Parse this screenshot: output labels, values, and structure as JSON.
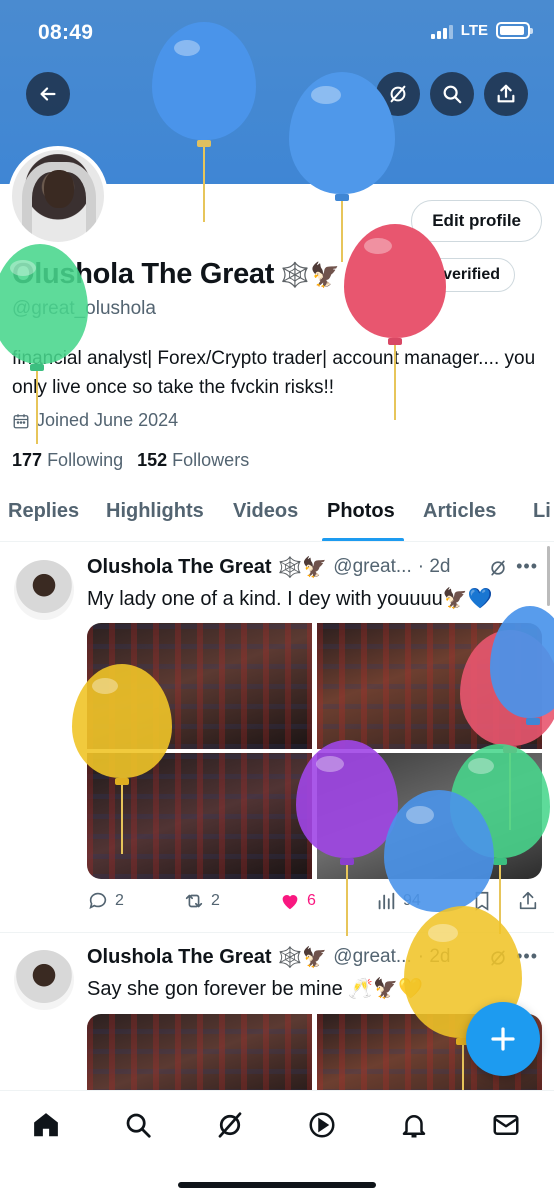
{
  "status_bar": {
    "time": "08:49",
    "network": "LTE"
  },
  "profile": {
    "name": "Olushola The Great",
    "name_emojis": "🕸️🦅",
    "handle": "@great_olushola",
    "bio": "financial analyst| Forex/Crypto trader| account manager.... you only live once so take the fvckin risks!!",
    "joined": "Joined June 2024",
    "following_count": "177",
    "following_label": "Following",
    "followers_count": "152",
    "followers_label": "Followers",
    "edit_label": "Edit profile",
    "verify_label": "Get verified"
  },
  "tabs": [
    {
      "label": "Replies"
    },
    {
      "label": "Highlights"
    },
    {
      "label": "Videos"
    },
    {
      "label": "Photos"
    },
    {
      "label": "Articles"
    },
    {
      "label": "Li"
    }
  ],
  "posts": [
    {
      "name": "Olushola The Great",
      "emojis": "🕸️🦅",
      "handle": "@great...",
      "time": "· 2d",
      "text": "My lady one of a kind. I dey with youuuu🦅💙",
      "replies": "2",
      "reposts": "2",
      "likes": "6",
      "views": "94"
    },
    {
      "name": "Olushola The Great",
      "emojis": "🕸️🦅",
      "handle": "@great...",
      "time": "· 2d",
      "text": "Say she gon forever be mine 🥂🦅💛"
    }
  ],
  "icons": {
    "back": "arrow-left-icon",
    "grok": "grok-icon",
    "search": "search-icon",
    "share": "share-icon",
    "compose": "plus-icon"
  },
  "colors": {
    "banner": "#3f86d4",
    "accent": "#1d9bf0",
    "like": "#f91880"
  }
}
